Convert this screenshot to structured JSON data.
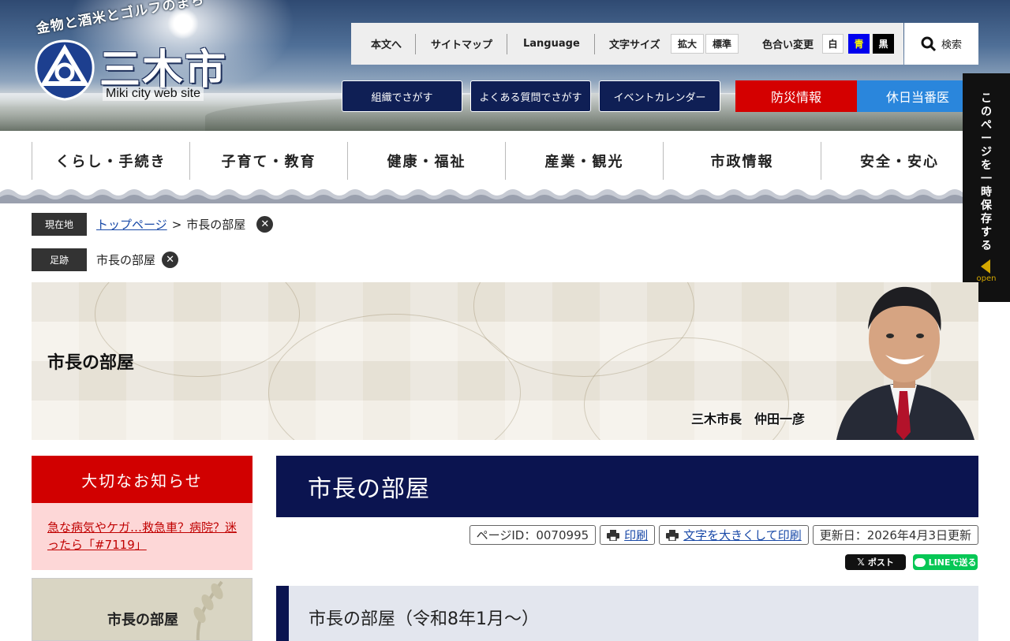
{
  "header": {
    "tagline": "金物と酒米とゴルフのまち",
    "city_name": "三木市",
    "site_sub": "Miki city web site",
    "util": {
      "honbun": "本文へ",
      "sitemap": "サイトマップ",
      "language": "Language",
      "font_size_label": "文字サイズ",
      "enlarge": "拡大",
      "standard": "標準",
      "color_label": "色合い変更",
      "white": "白",
      "blue": "青",
      "black": "黒",
      "search": "検索"
    },
    "nav_buttons": {
      "org": "組織でさがす",
      "faq": "よくある質問でさがす",
      "event": "イベントカレンダー",
      "disaster": "防災情報",
      "holiday": "休日当番医"
    }
  },
  "gnav": [
    "くらし・手続き",
    "子育て・教育",
    "健康・福祉",
    "産業・観光",
    "市政情報",
    "安全・安心"
  ],
  "side_tab": {
    "text": "このページを一時保存する",
    "open": "open"
  },
  "breadcrumb": {
    "current_label": "現在地",
    "top_link": "トップページ",
    "separator": ">",
    "current_page": "市長の部屋",
    "history_label": "足跡",
    "history_item": "市長の部屋",
    "close_glyph": "✕"
  },
  "hero": {
    "title": "市長の部屋",
    "caption": "三木市長　仲田一彦"
  },
  "sidebar": {
    "notice_title": "大切なお知らせ",
    "notice_link": "急な病気やケガ…救急車？病院？迷ったら「#7119」",
    "room_banner": "市長の部屋"
  },
  "main": {
    "title": "市長の部屋",
    "page_id": "ページID：0070995",
    "print": "印刷",
    "print_large": "文字を大きくして印刷",
    "updated": "更新日：2026年4月3日更新",
    "share_x": "ポスト",
    "share_line": "LINEで送る",
    "subheading": "市長の部屋（令和8年1月～）"
  },
  "colors": {
    "navy": "#0b1450",
    "disaster_red": "#d40000",
    "holiday_blue": "#2a86dc",
    "notice_red": "#d10000",
    "notice_bg": "#fdd7d7"
  }
}
